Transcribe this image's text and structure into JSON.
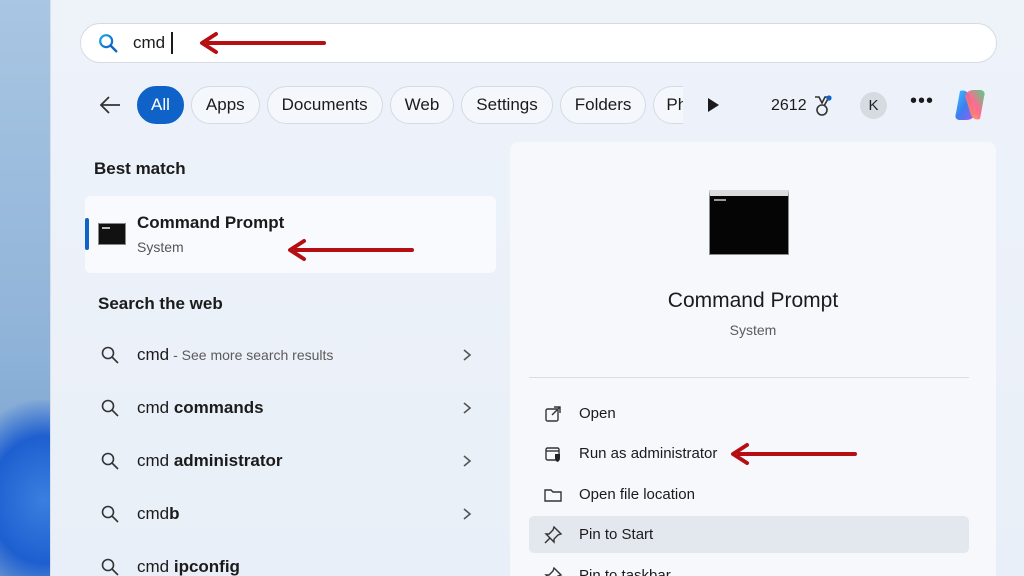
{
  "search": {
    "value": "cmd"
  },
  "filters": {
    "chips": [
      "All",
      "Apps",
      "Documents",
      "Web",
      "Settings",
      "Folders",
      "Ph"
    ],
    "points": "2612",
    "avatar_initial": "K"
  },
  "best_match": {
    "heading": "Best match",
    "name": "Command Prompt",
    "subtitle": "System"
  },
  "web": {
    "heading": "Search the web",
    "items": [
      {
        "prefix": "cmd",
        "bold": "",
        "hint": "- See more search results"
      },
      {
        "prefix": "cmd ",
        "bold": "commands",
        "hint": ""
      },
      {
        "prefix": "cmd ",
        "bold": "administrator",
        "hint": ""
      },
      {
        "prefix": "cmd",
        "bold": "b",
        "hint": ""
      },
      {
        "prefix": "cmd ",
        "bold": "ipconfig",
        "hint": ""
      }
    ]
  },
  "details": {
    "title": "Command Prompt",
    "subtitle": "System",
    "actions": [
      "Open",
      "Run as administrator",
      "Open file location",
      "Pin to Start",
      "Pin to taskbar"
    ]
  },
  "colors": {
    "accent": "#0f63c8",
    "annotation": "#b50f14"
  }
}
